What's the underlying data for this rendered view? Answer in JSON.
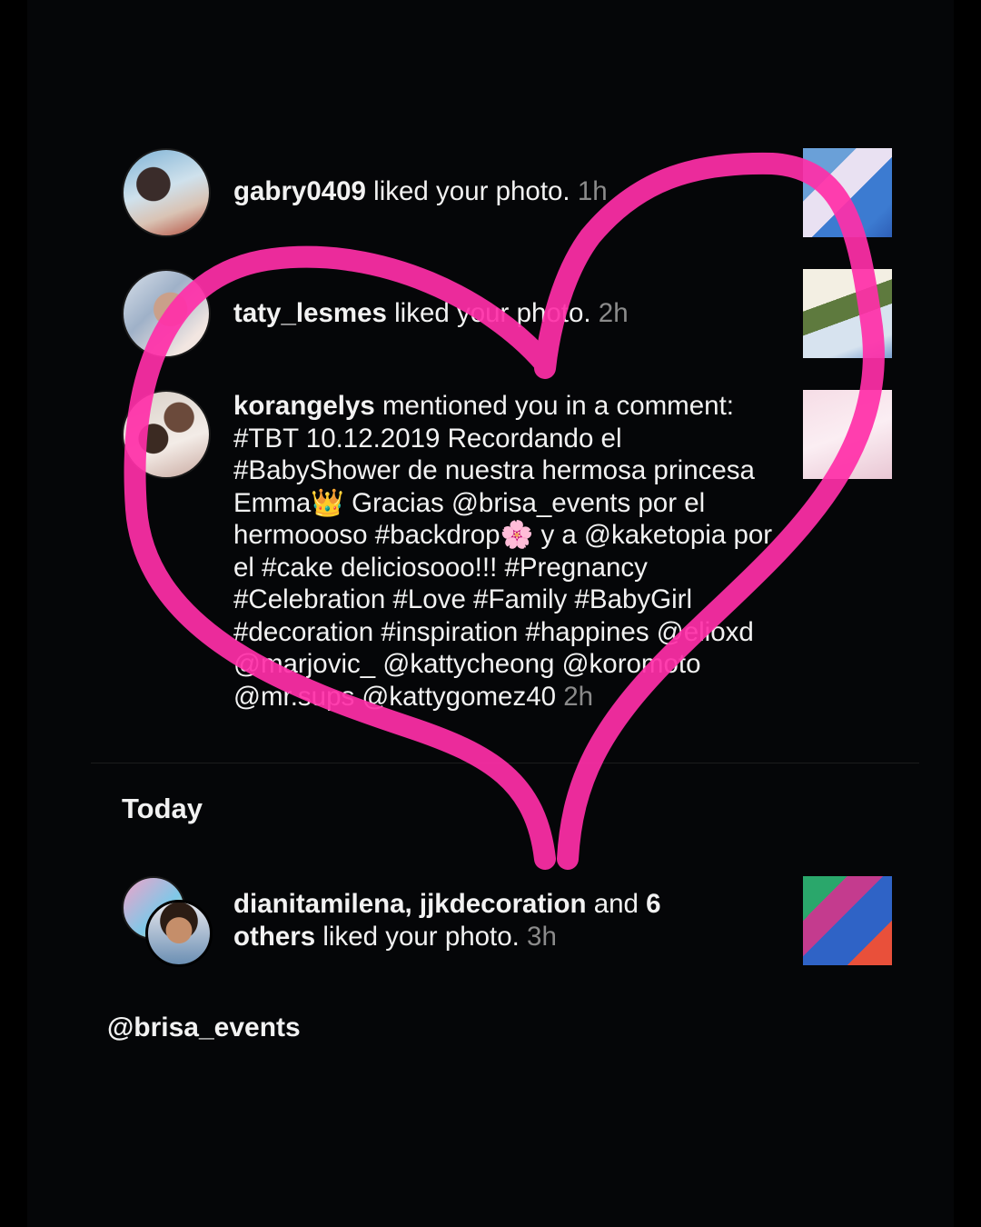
{
  "notifications": [
    {
      "user": "gabry0409",
      "action": " liked your photo.",
      "time": " 1h",
      "avatar_icon": "user-avatar-photo",
      "thumb_icon": "post-thumbnail-photo"
    },
    {
      "user": "taty_lesmes",
      "action": " liked your photo.",
      "time": " 2h",
      "avatar_icon": "user-avatar-photo",
      "thumb_icon": "post-thumbnail-photo"
    },
    {
      "user": "korangelys",
      "action": " mentioned you in a comment: #TBT 10.12.2019 Recordando el #BabyShower de nuestra hermosa princesa Emma👑 Gracias @brisa_events por el hermoooso #backdrop🌸 y a @kaketopia por el #cake deliciosooo!!! #Pregnancy #Celebration #Love #Family #BabyGirl #decoration #inspiration #happines @elioxd @marjovic_ @kattycheong @koromoto @mr.sups @kattygomez40",
      "time": " 2h",
      "avatar_icon": "user-avatar-photo",
      "thumb_icon": "post-thumbnail-photo"
    }
  ],
  "section_today": "Today",
  "today_notifications": [
    {
      "user": "dianitamilena, jjkdecoration",
      "action_and": " and ",
      "count_others": "6 others",
      "action": " liked your photo.",
      "time": " 3h",
      "avatar_icon": "stacked-user-avatars",
      "thumb_icon": "post-thumbnail-photo"
    }
  ],
  "footer_handle": "@brisa_events",
  "colors": {
    "heart_stroke": "#ff2fa8",
    "background": "#000000",
    "text": "#f2f2f2",
    "time_muted": "#8b8b8b"
  }
}
